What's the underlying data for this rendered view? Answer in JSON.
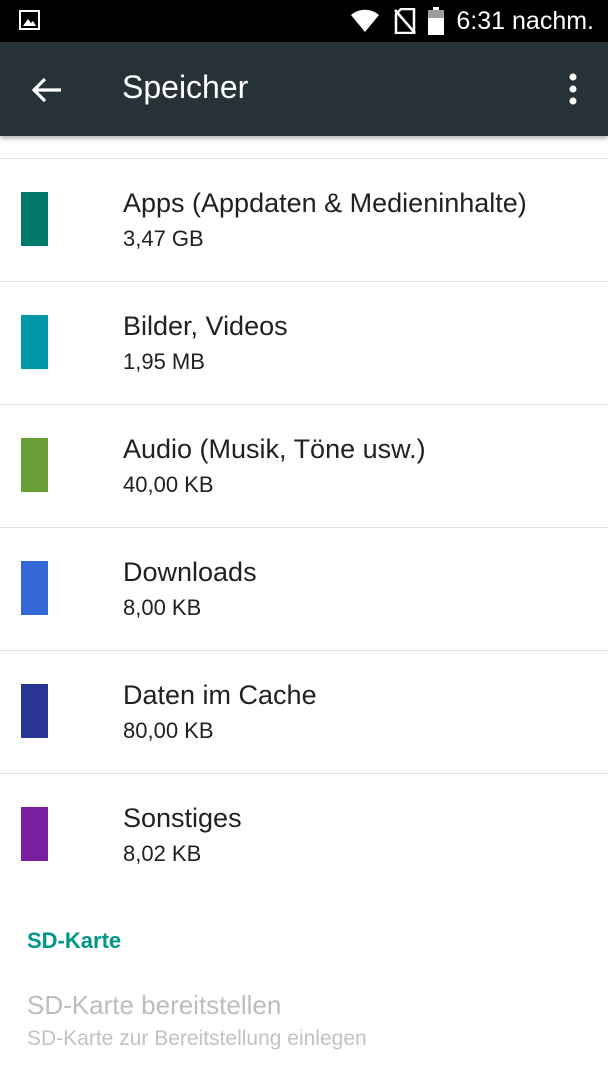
{
  "status_bar": {
    "time": "6:31 nachm.",
    "icons": [
      "gallery-notification-icon",
      "wifi-icon",
      "no-sim-icon",
      "battery-icon"
    ]
  },
  "app_bar": {
    "title": "Speicher",
    "back_icon": "arrow-back-icon",
    "menu_icon": "more-vertical-icon",
    "background": "#263238"
  },
  "storage_items": [
    {
      "label": "Apps (Appdaten & Medieninhalte)",
      "size": "3,47 GB",
      "color": "#00796B"
    },
    {
      "label": "Bilder, Videos",
      "size": "1,95 MB",
      "color": "#0097A7"
    },
    {
      "label": "Audio (Musik, Töne usw.)",
      "size": "40,00 KB",
      "color": "#689F38"
    },
    {
      "label": "Downloads",
      "size": "8,00 KB",
      "color": "#3367D6"
    },
    {
      "label": "Daten im Cache",
      "size": "80,00 KB",
      "color": "#283593"
    },
    {
      "label": "Sonstiges",
      "size": "8,02 KB",
      "color": "#7B1FA2"
    }
  ],
  "sd_section": {
    "header": "SD-Karte",
    "accent": "#009688",
    "mount_title": "SD-Karte bereitstellen",
    "mount_summary": "SD-Karte zur Bereitstellung einlegen"
  }
}
